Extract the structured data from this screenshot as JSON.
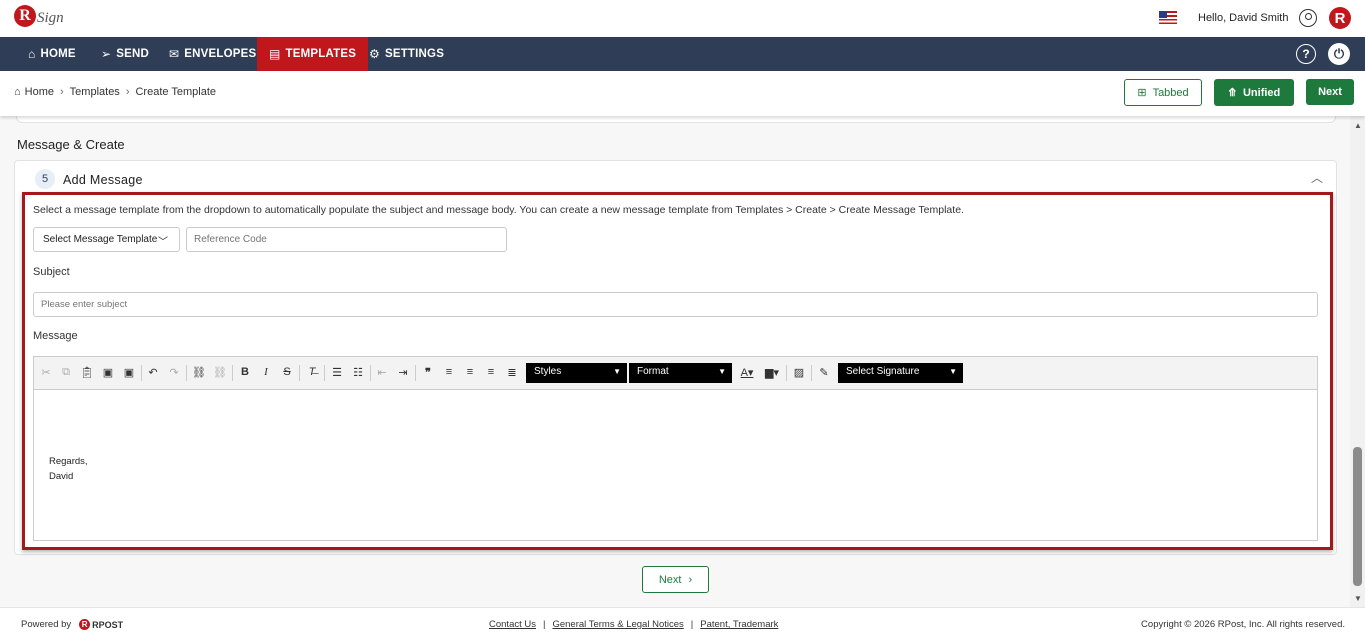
{
  "header": {
    "app_logo": "RSign",
    "greeting": "Hello, David Smith",
    "avatar_letter": "R"
  },
  "nav": {
    "items": [
      {
        "label": "HOME",
        "icon": "home-icon"
      },
      {
        "label": "SEND",
        "icon": "send-icon"
      },
      {
        "label": "ENVELOPES",
        "icon": "envelope-icon"
      },
      {
        "label": "TEMPLATES",
        "icon": "document-icon",
        "active": true
      },
      {
        "label": "SETTINGS",
        "icon": "gear-icon"
      }
    ],
    "help": "?",
    "power": "⏻"
  },
  "breadcrumb": {
    "items": [
      "Home",
      "Templates",
      "Create Template"
    ]
  },
  "actions": {
    "tabbed": "Tabbed",
    "unified": "Unified",
    "next": "Next"
  },
  "section": {
    "title": "Message & Create",
    "step_number": "5",
    "step_title": "Add Message",
    "instructions": "Select a message template from the dropdown to automatically populate the subject and message body. You can create a new message template from Templates > Create > Create Message Template.",
    "select_template": "Select Message Template",
    "reference_placeholder": "Reference Code",
    "subject_label": "Subject",
    "subject_placeholder": "Please enter subject",
    "message_label": "Message",
    "toolbar": {
      "styles": "Styles",
      "format": "Format",
      "signature": "Select Signature"
    },
    "body_lines": [
      "Regards,",
      "David"
    ],
    "next_button": "Next"
  },
  "footer": {
    "powered_by": "Powered by",
    "brand": "RPOST",
    "links": [
      "Contact Us",
      "General Terms & Legal Notices",
      "Patent, Trademark"
    ],
    "copyright": "Copyright © 2026 RPost, Inc. All rights reserved."
  },
  "colors": {
    "nav_bg": "#2f3e56",
    "active_tab": "#c0171d",
    "primary_green": "#1e7a3c",
    "highlight_border": "#a5171c"
  }
}
